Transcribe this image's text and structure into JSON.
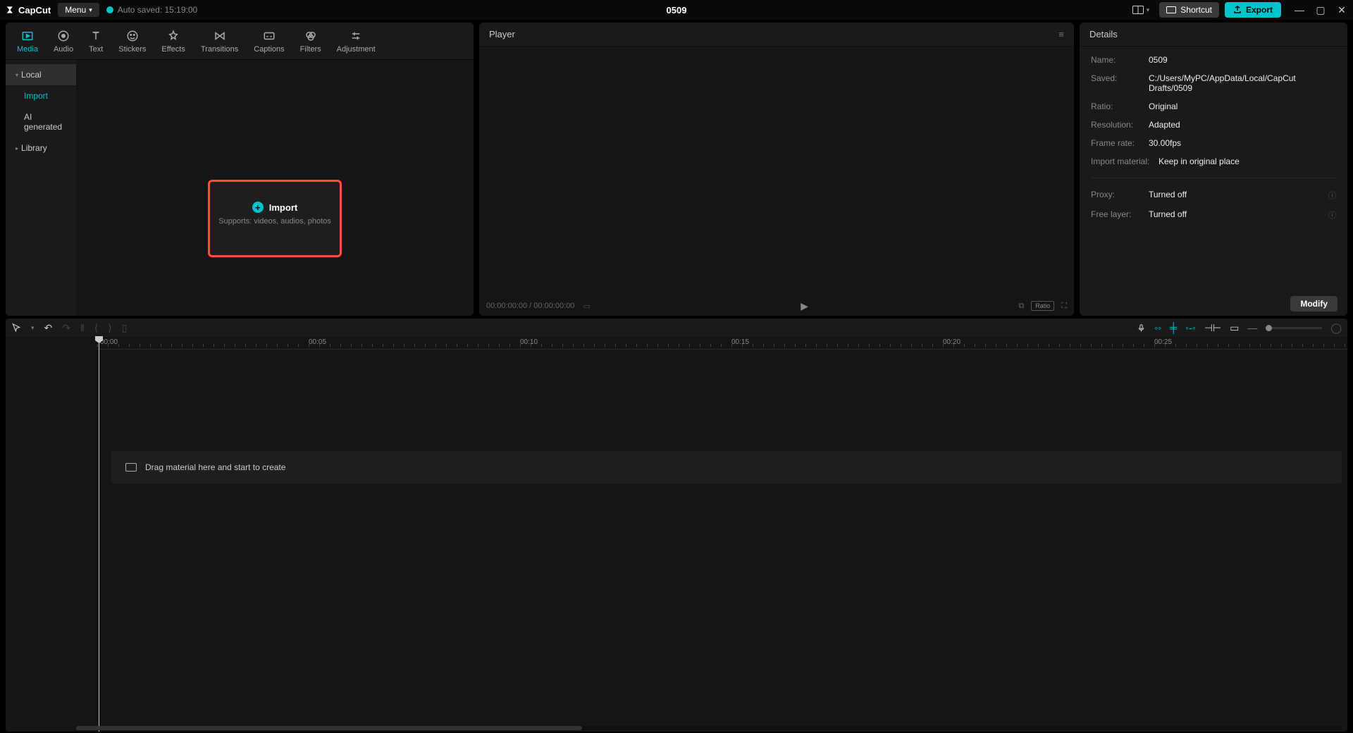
{
  "titlebar": {
    "app_name": "CapCut",
    "menu_label": "Menu",
    "autosave_text": "Auto saved: 15:19:00",
    "project_name": "0509",
    "shortcut_label": "Shortcut",
    "export_label": "Export"
  },
  "tabs": {
    "media": "Media",
    "audio": "Audio",
    "text": "Text",
    "stickers": "Stickers",
    "effects": "Effects",
    "transitions": "Transitions",
    "captions": "Captions",
    "filters": "Filters",
    "adjustment": "Adjustment"
  },
  "sidebar": {
    "local": "Local",
    "import": "Import",
    "ai_generated": "AI generated",
    "library": "Library"
  },
  "import_box": {
    "label": "Import",
    "sub": "Supports: videos, audios, photos"
  },
  "player": {
    "title": "Player",
    "time": "00:00:00:00 / 00:00:00:00",
    "ratio_badge": "Ratio"
  },
  "details": {
    "title": "Details",
    "rows": {
      "name_label": "Name:",
      "name_value": "0509",
      "saved_label": "Saved:",
      "saved_value": "C:/Users/MyPC/AppData/Local/CapCut Drafts/0509",
      "ratio_label": "Ratio:",
      "ratio_value": "Original",
      "resolution_label": "Resolution:",
      "resolution_value": "Adapted",
      "framerate_label": "Frame rate:",
      "framerate_value": "30.00fps",
      "import_label": "Import material:",
      "import_value": "Keep in original place",
      "proxy_label": "Proxy:",
      "proxy_value": "Turned off",
      "freelayer_label": "Free layer:",
      "freelayer_value": "Turned off"
    },
    "modify": "Modify"
  },
  "timeline": {
    "drop_hint": "Drag material here and start to create",
    "ticks": [
      "00:00",
      "00:05",
      "00:10",
      "00:15",
      "00:20",
      "00:25"
    ]
  }
}
